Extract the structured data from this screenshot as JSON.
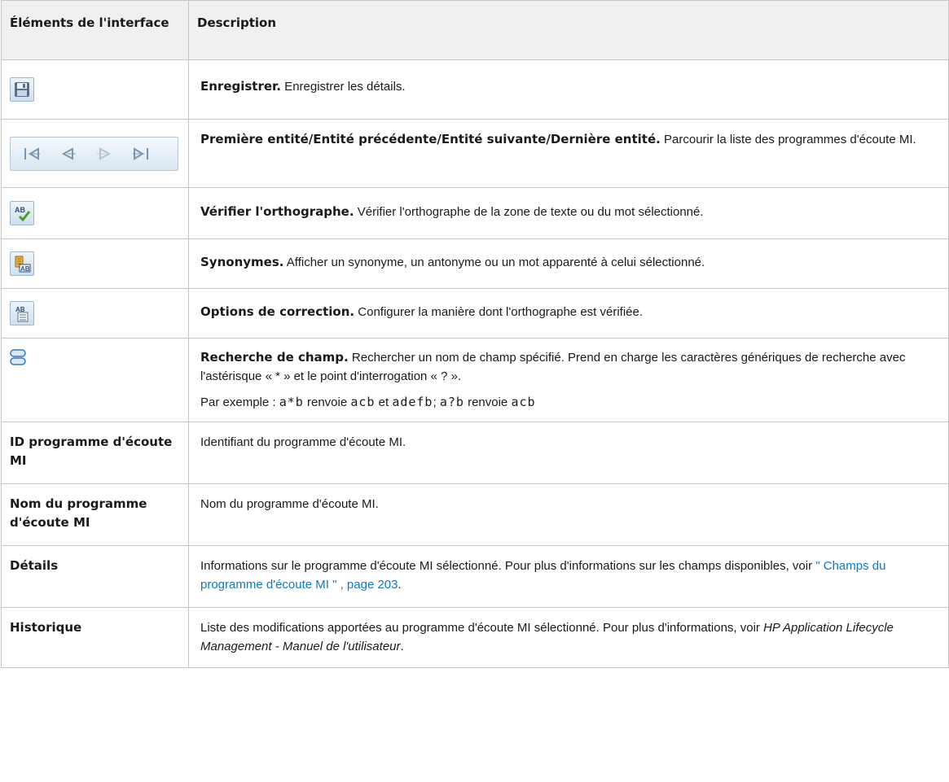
{
  "header": {
    "col1": "Éléments de l'interface",
    "col2": "Description"
  },
  "rows": [
    {
      "icon": "save-icon",
      "title": "Enregistrer.",
      "text": " Enregistrer les détails."
    },
    {
      "icon": "navigation-arrows-icon",
      "title": "Première entité/Entité précédente/Entité suivante/Dernière entité.",
      "text": " Parcourir la liste des programmes d'écoute MI."
    },
    {
      "icon": "spell-check-icon",
      "title": "Vérifier l'orthographe.",
      "text": " Vérifier l'orthographe de la zone de texte ou du mot sélectionné."
    },
    {
      "icon": "thesaurus-icon",
      "title": "Synonymes.",
      "text": " Afficher un synonyme, un antonyme ou un mot apparenté à celui sélectionné."
    },
    {
      "icon": "spelling-options-icon",
      "title": "Options de correction.",
      "text": " Configurer la manière dont l'orthographe est vérifiée."
    },
    {
      "icon": "field-search-icon",
      "title": "Recherche de champ.",
      "text": " Rechercher un nom de champ spécifié. Prend en charge les caractères génériques de recherche avec l'astérisque « * » et le point d'interrogation « ? ».",
      "example": {
        "prefix": "Par exemple : ",
        "code1": "a*b",
        "w1": " renvoie ",
        "code2": "acb",
        "w2": " et ",
        "code3": "adefb",
        "w3": "; ",
        "code4": "a?b",
        "w4": " renvoie ",
        "code5": "acb"
      }
    }
  ],
  "text_rows": [
    {
      "name": "ID programme d'écoute MI",
      "desc": "Identifiant du programme d'écoute MI."
    },
    {
      "name": "Nom du programme d'écoute MI",
      "desc": "Nom du programme d'écoute MI."
    }
  ],
  "details": {
    "name": "Détails",
    "desc": "Informations sur le programme d'écoute MI sélectionné. Pour plus d'informations sur les champs disponibles, voir ",
    "link": "\" Champs du programme d'écoute MI \" , page 203",
    "end": "."
  },
  "historique": {
    "name": "Historique",
    "desc": "Liste des modifications apportées au programme d'écoute MI sélectionné. Pour plus d'informations, voir ",
    "ref": "HP Application Lifecycle Management - Manuel de l'utilisateur",
    "end": "."
  }
}
